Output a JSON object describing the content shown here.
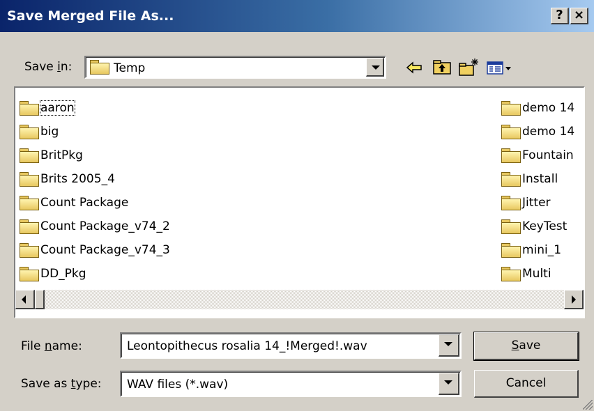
{
  "window": {
    "title": "Save Merged File As...",
    "help_button": "?",
    "close_button": "×"
  },
  "save_in": {
    "label_pre": "Save ",
    "label_accel": "i",
    "label_post": "n:",
    "value": "Temp"
  },
  "toolbar": {
    "icons": [
      "back-arrow-icon",
      "up-one-level-icon",
      "create-new-folder-icon",
      "view-menu-icon"
    ]
  },
  "file_list": {
    "left_column": [
      "aaron",
      "big",
      "BritPkg",
      "Brits 2005_4",
      "Count Package",
      "Count Package_v74_2",
      "Count Package_v74_3",
      "DD_Pkg"
    ],
    "right_column": [
      "demo 14",
      "demo 14",
      "Fountain",
      "Install",
      "Jitter",
      "KeyTest",
      "mini_1",
      "Multi"
    ]
  },
  "file_name": {
    "label_pre": "File ",
    "label_accel": "n",
    "label_post": "ame:",
    "value": "Leontopithecus rosalia 14_!Merged!.wav"
  },
  "save_as_type": {
    "label_pre": "Save as ",
    "label_accel": "t",
    "label_post": "ype:",
    "value": "WAV files (*.wav)"
  },
  "buttons": {
    "save_accel": "S",
    "save_rest": "ave",
    "cancel": "Cancel"
  }
}
